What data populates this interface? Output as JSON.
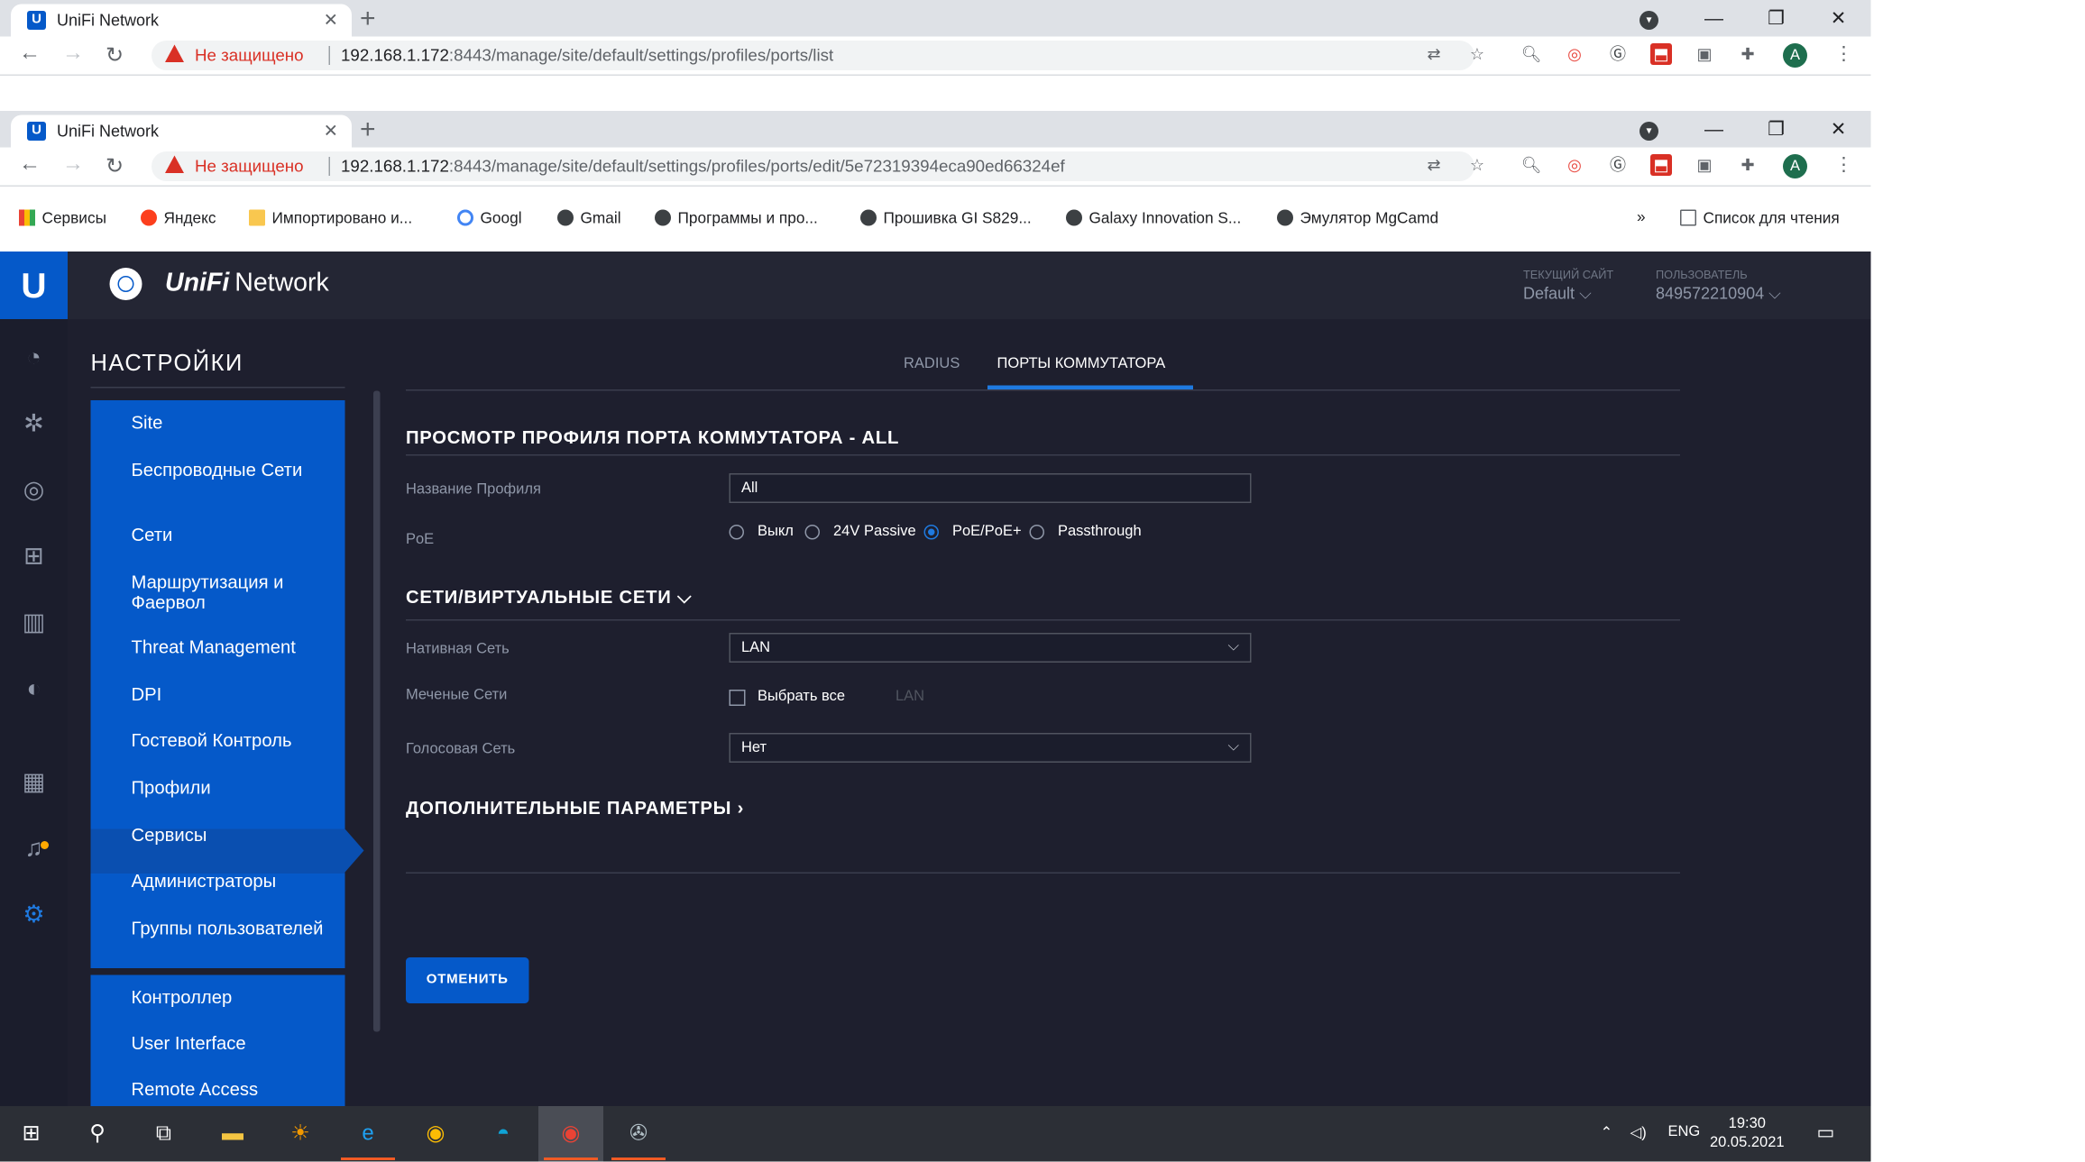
{
  "browser_back": {
    "tab_title": "UniFi Network",
    "security_label": "Не защищено",
    "url_host": "192.168.1.172",
    "url_path": ":8443/manage/site/default/settings/profiles/ports/list"
  },
  "browser_front": {
    "tab_title": "UniFi Network",
    "security_label": "Не защищено",
    "url_host": "192.168.1.172",
    "url_path": ":8443/manage/site/default/settings/profiles/ports/edit/5e72319394eca90ed66324ef",
    "avatar_letter": "A"
  },
  "bookmarks": [
    "Сервисы",
    "Яндекс",
    "Импортировано и...",
    "Googl",
    "Gmail",
    "Программы и про...",
    "Прошивка GI S829...",
    "Galaxy Innovation S...",
    "Эмулятор MgCamd"
  ],
  "reading_list": "Список для чтения",
  "bookmark_overflow": "»",
  "app": {
    "logo_letter": "U",
    "brand_bold": "UniFi",
    "brand_rest": "Network",
    "current_site_label": "ТЕКУЩИЙ САЙТ",
    "current_site_value": "Default",
    "user_label": "ПОЛЬЗОВАТЕЛЬ",
    "user_value": "849572210904"
  },
  "settings": {
    "title": "НАСТРОЙКИ",
    "items": [
      "Site",
      "Беспроводные Сети",
      "Сети",
      "Маршрутизация и Фаервол",
      "Threat Management",
      "DPI",
      "Гостевой Контроль",
      "Профили",
      "Сервисы",
      "Администраторы",
      "Группы пользователей"
    ],
    "items2": [
      "Контроллер",
      "User Interface",
      "Remote Access"
    ]
  },
  "tabs": [
    "RADIUS",
    "ПОРТЫ КОММУТАТОРА"
  ],
  "profile_section": {
    "title": "ПРОСМОТР ПРОФИЛЯ ПОРТА КОММУТАТОРА - ALL",
    "name_label": "Название Профиля",
    "name_value": "All",
    "poe_label": "PoE",
    "poe_options": [
      "Выкл",
      "24V Passive",
      "PoE/PoE+",
      "Passthrough"
    ],
    "poe_selected": "PoE/PoE+"
  },
  "networks_section": {
    "title": "СЕТИ/ВИРТУАЛЬНЫЕ СЕТИ",
    "native_label": "Нативная Сеть",
    "native_value": "LAN",
    "tagged_label": "Меченые Сети",
    "select_all": "Выбрать все",
    "tagged_option": "LAN",
    "voice_label": "Голосовая Сеть",
    "voice_value": "Нет"
  },
  "advanced_title": "ДОПОЛНИТЕЛЬНЫЕ ПАРАМЕТРЫ",
  "cancel_label": "ОТМЕНИТЬ",
  "taskbar": {
    "lang": "ENG",
    "time": "19:30",
    "date": "20.05.2021"
  },
  "colors": {
    "accent": "#0559c9",
    "app_bg": "#1e1f2e",
    "nav_bg": "#1b1d2c"
  }
}
